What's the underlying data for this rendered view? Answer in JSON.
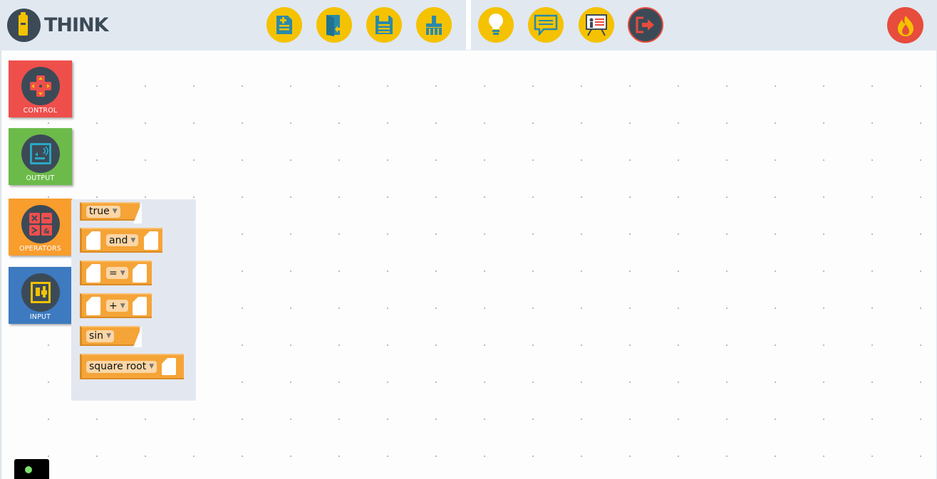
{
  "app": {
    "name": "THINK"
  },
  "toolbar_left": [
    {
      "name": "new-file-button",
      "icon": "new-file-icon"
    },
    {
      "name": "open-file-button",
      "icon": "open-folder-icon"
    },
    {
      "name": "save-button",
      "icon": "save-icon"
    },
    {
      "name": "clear-button",
      "icon": "broom-icon"
    }
  ],
  "toolbar_right": [
    {
      "name": "hint-button",
      "icon": "lightbulb-icon"
    },
    {
      "name": "chat-button",
      "icon": "chat-icon"
    },
    {
      "name": "presentation-button",
      "icon": "presentation-icon"
    },
    {
      "name": "logout-button",
      "icon": "logout-icon"
    }
  ],
  "categories": [
    {
      "label": "CONTROL",
      "color": "#ee4f4b",
      "icon": "dpad-icon"
    },
    {
      "label": "OUTPUT",
      "color": "#6cbb4a",
      "icon": "output-icon"
    },
    {
      "label": "OPERATORS",
      "color": "#f99d2d",
      "icon": "calculator-icon"
    },
    {
      "label": "INPUT",
      "color": "#3d7ac0",
      "icon": "input-icon"
    }
  ],
  "blocks": [
    {
      "type": "boolean",
      "value": "true"
    },
    {
      "type": "logic",
      "op": "and"
    },
    {
      "type": "compare",
      "op": "="
    },
    {
      "type": "arithmetic",
      "op": "+"
    },
    {
      "type": "trig",
      "fn": "sin"
    },
    {
      "type": "math",
      "fn": "square root"
    }
  ],
  "colors": {
    "accent": "#f4c200",
    "header": "#e1e8f0",
    "operator_block": "#f5a437",
    "dark": "#3c4a57"
  },
  "status": {
    "indicator_color": "#7be36d"
  }
}
